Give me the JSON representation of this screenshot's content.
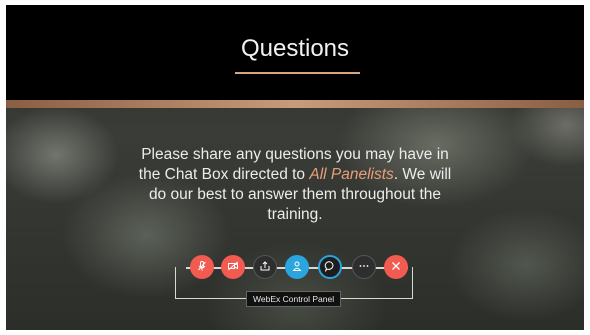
{
  "slide": {
    "title": "Questions",
    "body_before": "Please share any questions you may have in the Chat Box directed to ",
    "body_highlight": "All Panelists",
    "body_after": ". We will do our best to answer them throughout the training."
  },
  "control_panel": {
    "tooltip": "WebEx Control Panel",
    "buttons": [
      {
        "icon": "microphone-muted-icon",
        "color": "#f25b4f"
      },
      {
        "icon": "video-off-icon",
        "color": "#f25b4f"
      },
      {
        "icon": "share-icon",
        "color": "#2e2e2e"
      },
      {
        "icon": "participants-icon",
        "color": "#2aa5dd"
      },
      {
        "icon": "chat-icon",
        "color": "#2aa5dd"
      },
      {
        "icon": "more-icon",
        "color": "#2e2e2e"
      },
      {
        "icon": "close-icon",
        "color": "#f25b4f"
      }
    ]
  },
  "colors": {
    "title_bar": "#000000",
    "accent": "#c89b7b",
    "highlight_text": "#e8a07a"
  }
}
